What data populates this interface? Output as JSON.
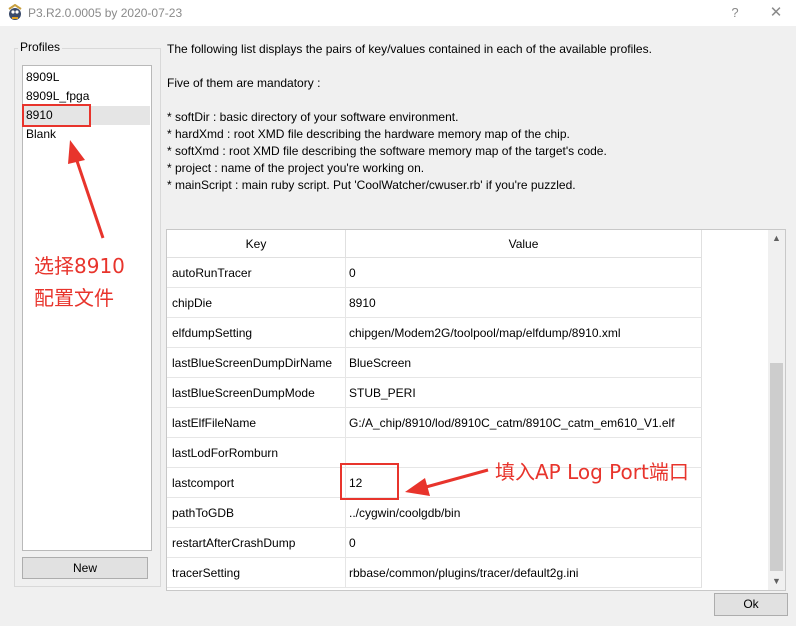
{
  "window": {
    "title": "P3.R2.0.0005 by 2020-07-23",
    "help_label": "?",
    "close_label": "✕",
    "icon": "app-icon"
  },
  "profiles": {
    "legend": "Profiles",
    "items": [
      "8909L",
      "8909L_fpga",
      "8910",
      "Blank"
    ],
    "selected": "8910",
    "new_label": "New"
  },
  "description": {
    "intro": "The following list displays the pairs of key/values contained in each of the available profiles.",
    "mandatory": "Five of them are mandatory :",
    "bullets": [
      "* softDir : basic directory of your software environment.",
      "* hardXmd : root XMD file describing the hardware memory map of the chip.",
      "* softXmd : root XMD file describing the software memory map of the target's code.",
      "* project : name of the project you're working on.",
      "* mainScript : main ruby script. Put 'CoolWatcher/cwuser.rb' if you're puzzled."
    ]
  },
  "table": {
    "headers": {
      "key": "Key",
      "value": "Value"
    },
    "rows": [
      {
        "key": "autoRunTracer",
        "value": "0"
      },
      {
        "key": "chipDie",
        "value": "8910"
      },
      {
        "key": "elfdumpSetting",
        "value": "chipgen/Modem2G/toolpool/map/elfdump/8910.xml"
      },
      {
        "key": "lastBlueScreenDumpDirName",
        "value": "BlueScreen"
      },
      {
        "key": "lastBlueScreenDumpMode",
        "value": "STUB_PERI"
      },
      {
        "key": "lastElfFileName",
        "value": "G:/A_chip/8910/lod/8910C_catm/8910C_catm_em610_V1.elf"
      },
      {
        "key": "lastLodForRomburn",
        "value": ""
      },
      {
        "key": "lastcomport",
        "value": "12"
      },
      {
        "key": "pathToGDB",
        "value": "../cygwin/coolgdb/bin"
      },
      {
        "key": "restartAfterCrashDump",
        "value": "0"
      },
      {
        "key": "tracerSetting",
        "value": "rbbase/common/plugins/tracer/default2g.ini"
      }
    ]
  },
  "scrollbar": {
    "up_glyph": "▲",
    "down_glyph": "▼"
  },
  "buttons": {
    "ok_label": "Ok"
  },
  "annotations": {
    "profile_note_line1": "选择8910",
    "profile_note_line2": "配置文件",
    "port_note": "填入AP Log Port端口",
    "color": "#e8342c"
  }
}
